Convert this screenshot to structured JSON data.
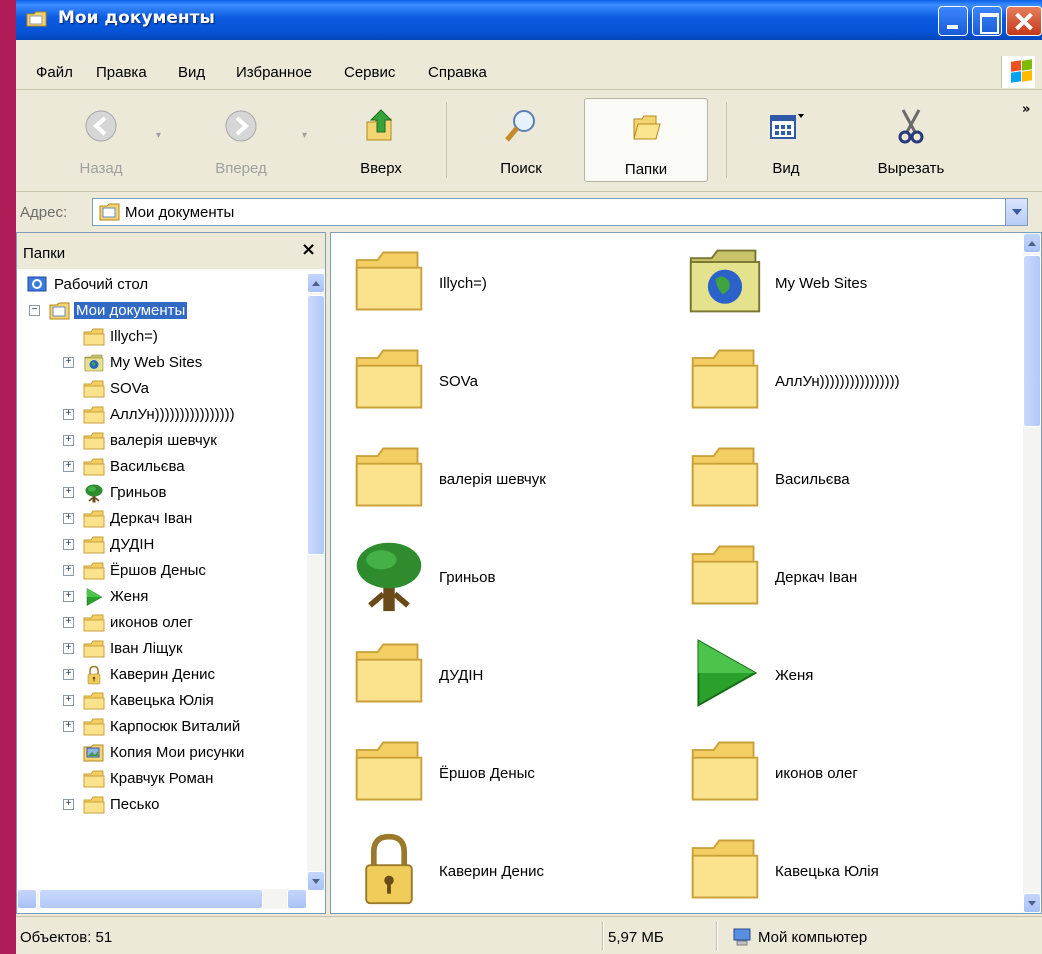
{
  "window": {
    "title": "Мои документы"
  },
  "menu": [
    "Файл",
    "Правка",
    "Вид",
    "Избранное",
    "Сервис",
    "Справка"
  ],
  "toolbar": {
    "back": "Назад",
    "forward": "Вперед",
    "up": "Вверх",
    "search": "Поиск",
    "folders": "Папки",
    "view": "Вид",
    "cut": "Вырезать",
    "more": "»"
  },
  "address": {
    "label": "Адрес:",
    "value": "Мои документы"
  },
  "folders_panel": {
    "title": "Папки",
    "close": "×",
    "tree": [
      {
        "label": "Рабочий стол",
        "icon": "desktop-icon"
      },
      {
        "label": "Мои документы",
        "icon": "my-documents-icon",
        "expanded": true,
        "selected": true
      },
      {
        "label": "Illych=)",
        "icon": "folder-icon"
      },
      {
        "label": "My Web Sites",
        "icon": "web-folder-icon",
        "expandable": true
      },
      {
        "label": "SOVa",
        "icon": "folder-icon"
      },
      {
        "label": "АллУн))))))))))))))))",
        "icon": "folder-icon",
        "expandable": true
      },
      {
        "label": "валерія шевчук",
        "icon": "folder-icon",
        "expandable": true
      },
      {
        "label": "Васильєва",
        "icon": "folder-icon",
        "expandable": true
      },
      {
        "label": "Гриньов",
        "icon": "tree-icon",
        "expandable": true
      },
      {
        "label": "Деркач Іван",
        "icon": "folder-icon",
        "expandable": true
      },
      {
        "label": "ДУДІН",
        "icon": "folder-icon",
        "expandable": true
      },
      {
        "label": "Ёршов Деныс",
        "icon": "folder-icon",
        "expandable": true
      },
      {
        "label": "Женя",
        "icon": "play-icon",
        "expandable": true
      },
      {
        "label": "иконов олег",
        "icon": "folder-icon",
        "expandable": true
      },
      {
        "label": "Іван Ліщук",
        "icon": "folder-icon",
        "expandable": true
      },
      {
        "label": "Каверин Денис",
        "icon": "lock-icon",
        "expandable": true
      },
      {
        "label": "Кавецька Юлія",
        "icon": "folder-icon",
        "expandable": true
      },
      {
        "label": "Карпосюк Виталий",
        "icon": "folder-icon",
        "expandable": true
      },
      {
        "label": "Копия Мои рисунки",
        "icon": "pictures-icon"
      },
      {
        "label": "Кравчук Роман",
        "icon": "folder-icon"
      },
      {
        "label": "Песько",
        "icon": "folder-icon",
        "expandable": true
      }
    ]
  },
  "files": [
    {
      "name": "Illych=)",
      "icon": "folder-icon"
    },
    {
      "name": "My Web Sites",
      "icon": "web-folder-icon"
    },
    {
      "name": "SOVa",
      "icon": "folder-icon"
    },
    {
      "name": "АллУн))))))))))))))))",
      "icon": "folder-icon"
    },
    {
      "name": "валерія шевчук",
      "icon": "folder-icon"
    },
    {
      "name": "Васильєва",
      "icon": "folder-icon"
    },
    {
      "name": "Гриньов",
      "icon": "tree-icon"
    },
    {
      "name": "Деркач Іван",
      "icon": "folder-icon"
    },
    {
      "name": "ДУДІН",
      "icon": "folder-icon"
    },
    {
      "name": "Женя",
      "icon": "play-icon"
    },
    {
      "name": "Ёршов Деныс",
      "icon": "folder-icon"
    },
    {
      "name": "иконов олег",
      "icon": "folder-icon"
    },
    {
      "name": "Каверин Денис",
      "icon": "lock-icon"
    },
    {
      "name": "Кавецька Юлія",
      "icon": "folder-icon"
    }
  ],
  "status": {
    "objects": "Объектов: 51",
    "size": "5,97 МБ",
    "location": "Мой компьютер"
  }
}
